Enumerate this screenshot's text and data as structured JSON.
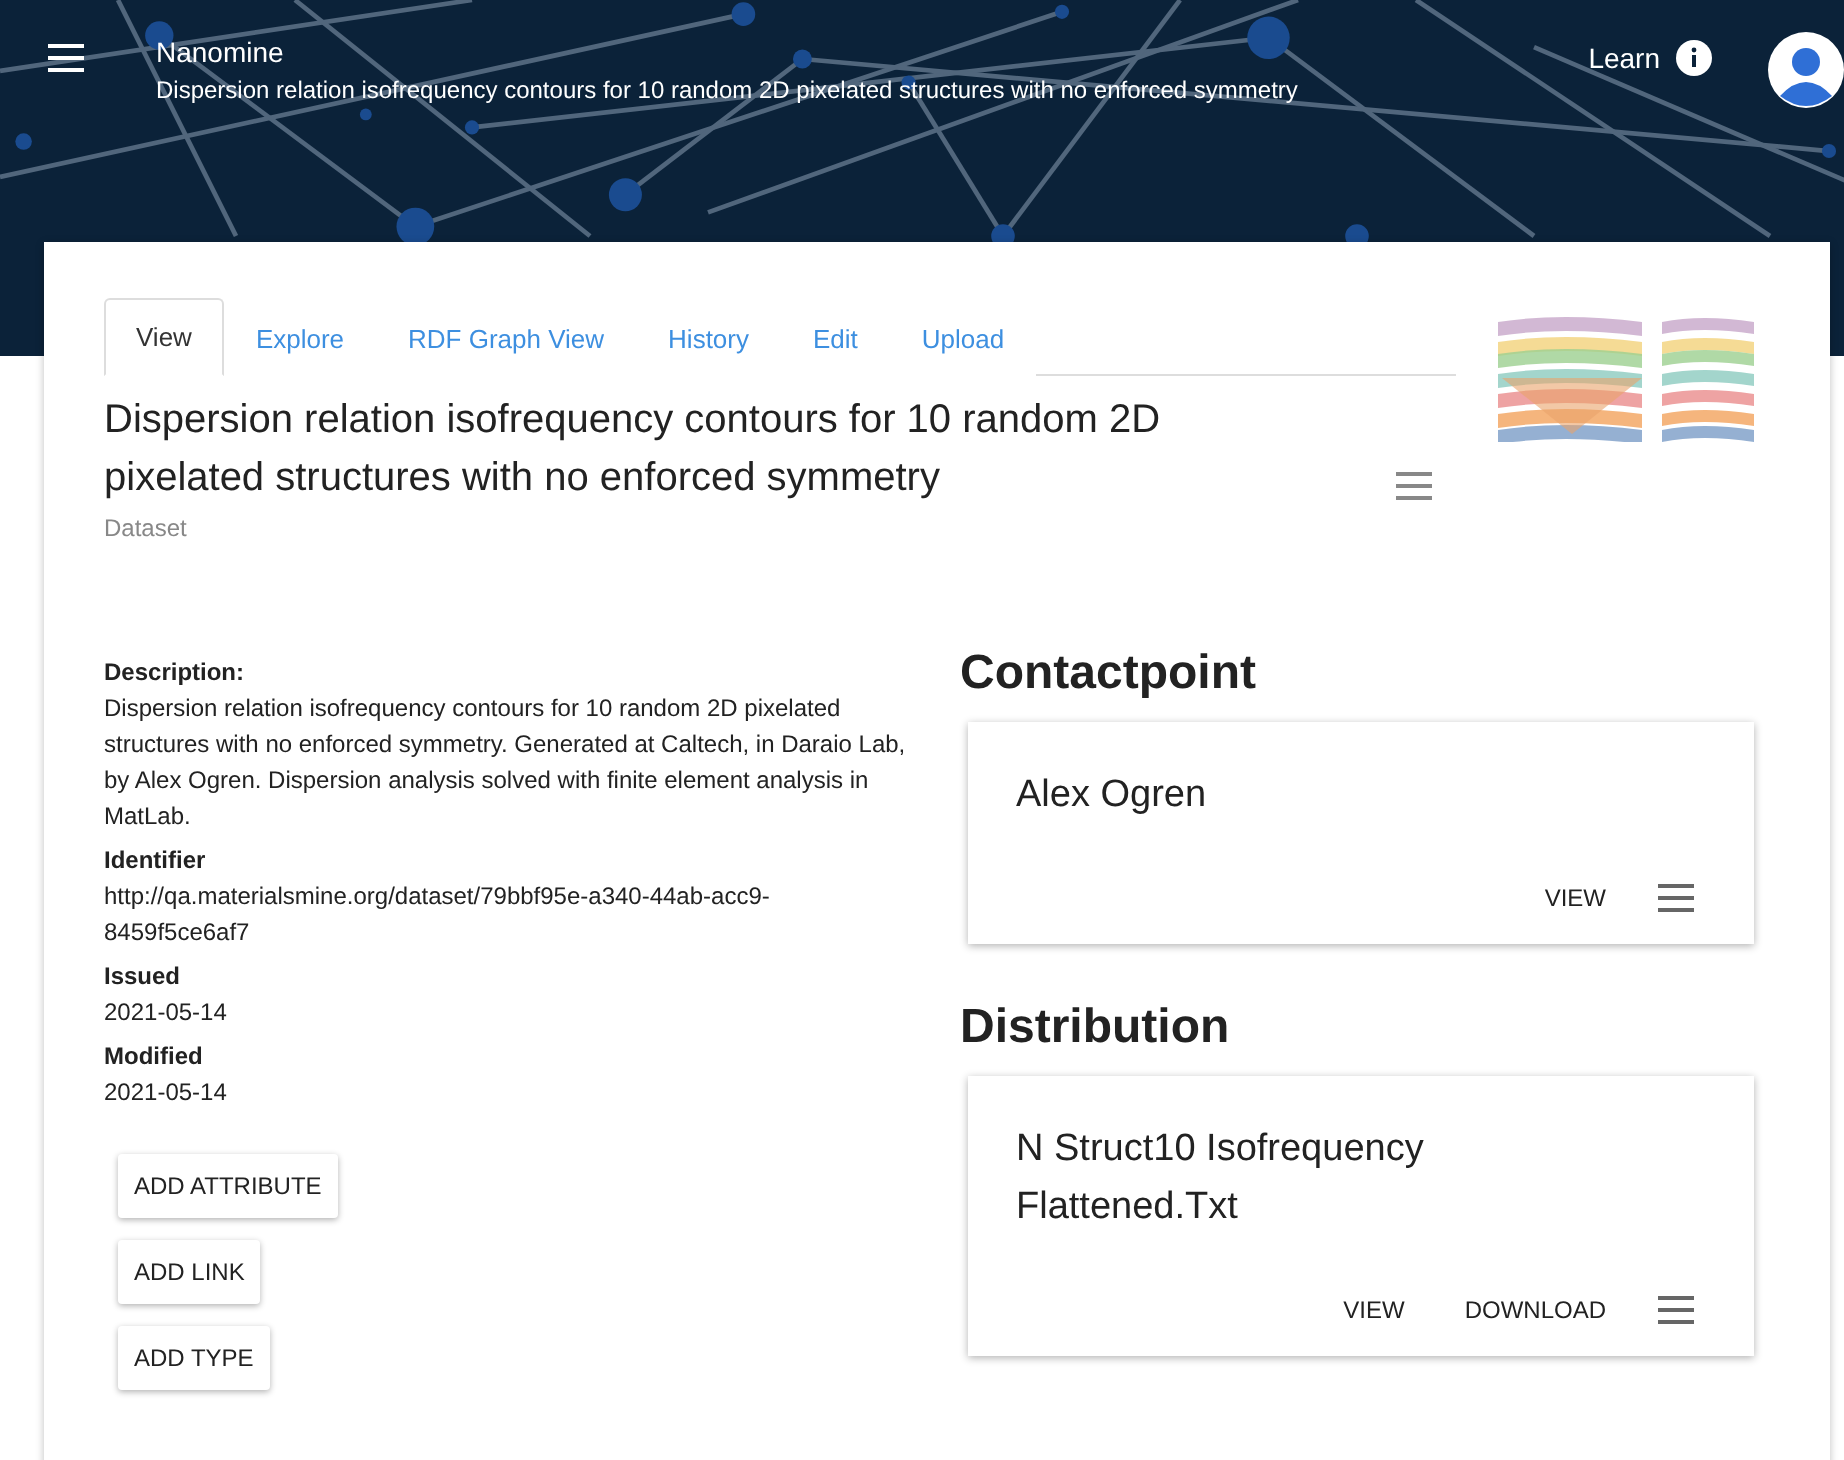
{
  "header": {
    "app_name": "Nanomine",
    "subtitle": "Dispersion relation isofrequency contours for 10 random 2D pixelated structures with no enforced symmetry",
    "learn": "Learn"
  },
  "tabs": [
    {
      "label": "View",
      "selected": true
    },
    {
      "label": "Explore",
      "selected": false
    },
    {
      "label": "RDF Graph View",
      "selected": false
    },
    {
      "label": "History",
      "selected": false
    },
    {
      "label": "Edit",
      "selected": false
    },
    {
      "label": "Upload",
      "selected": false
    }
  ],
  "thumbnail": {
    "kind": "picture"
  },
  "title": "Dispersion relation isofrequency contours for 10 random 2D pixelated structures with no enforced symmetry",
  "type": "Dataset",
  "fields": [
    {
      "label": "Description:",
      "value": "Dispersion relation isofrequency contours for 10 random 2D pixelated structures with no enforced symmetry. Generated at Caltech, in Daraio Lab, by Alex Ogren. Dispersion analysis solved with finite element analysis in MatLab."
    },
    {
      "label": "Identifier",
      "value": "http://qa.materialsmine.org/dataset/79bbf95e-a340-44ab-acc9-8459f5ce6af7"
    },
    {
      "label": "Issued",
      "value": "2021-05-14"
    },
    {
      "label": "Modified",
      "value": "2021-05-14"
    }
  ],
  "buttons": [
    "ADD ATTRIBUTE",
    "ADD LINK",
    "ADD TYPE"
  ],
  "sections": [
    {
      "heading": "Contactpoint",
      "card": {
        "title": "Alex Ogren",
        "actions": [
          "VIEW"
        ]
      }
    },
    {
      "heading": "Distribution",
      "card": {
        "title": "N Struct10 Isofrequency Flattened.Txt",
        "actions": [
          "VIEW",
          "DOWNLOAD"
        ]
      }
    }
  ]
}
